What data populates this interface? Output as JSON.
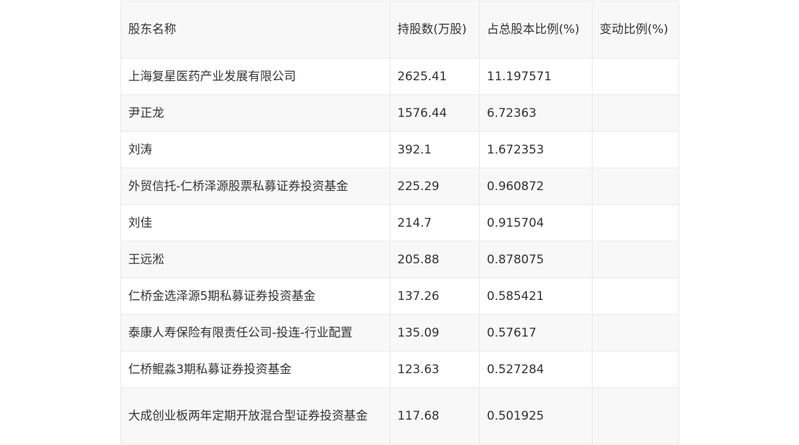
{
  "table": {
    "headers": {
      "name": "股东名称",
      "shares": "持股数(万股)",
      "ratio": "占总股本比例(%)",
      "change": "变动比例(%)"
    },
    "rows": [
      {
        "name": "上海复星医药产业发展有限公司",
        "shares": "2625.41",
        "ratio": "11.197571",
        "change": ""
      },
      {
        "name": "尹正龙",
        "shares": "1576.44",
        "ratio": "6.72363",
        "change": ""
      },
      {
        "name": "刘涛",
        "shares": "392.1",
        "ratio": "1.672353",
        "change": ""
      },
      {
        "name": "外贸信托-仁桥泽源股票私募证券投资基金",
        "shares": "225.29",
        "ratio": "0.960872",
        "change": ""
      },
      {
        "name": "刘佳",
        "shares": "214.7",
        "ratio": "0.915704",
        "change": ""
      },
      {
        "name": "王远淞",
        "shares": "205.88",
        "ratio": "0.878075",
        "change": ""
      },
      {
        "name": "仁桥金选泽源5期私募证券投资基金",
        "shares": "137.26",
        "ratio": "0.585421",
        "change": ""
      },
      {
        "name": "泰康人寿保险有限责任公司-投连-行业配置",
        "shares": "135.09",
        "ratio": "0.57617",
        "change": ""
      },
      {
        "name": "仁桥鲲淼3期私募证券投资基金",
        "shares": "123.63",
        "ratio": "0.527284",
        "change": ""
      },
      {
        "name": "大成创业板两年定期开放混合型证券投资基金",
        "shares": "117.68",
        "ratio": "0.501925",
        "change": ""
      }
    ]
  }
}
